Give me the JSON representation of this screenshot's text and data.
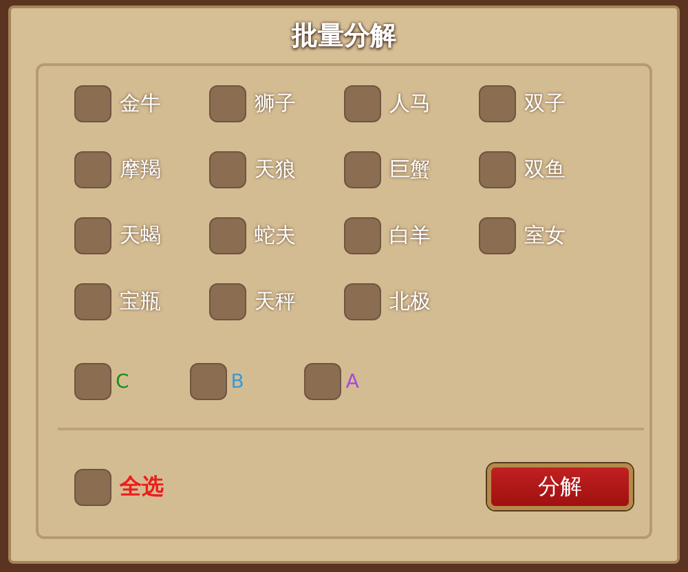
{
  "title": "批量分解",
  "options": [
    {
      "label": "金牛",
      "checked": false
    },
    {
      "label": "狮子",
      "checked": false
    },
    {
      "label": "人马",
      "checked": false
    },
    {
      "label": "双子",
      "checked": false
    },
    {
      "label": "摩羯",
      "checked": false
    },
    {
      "label": "天狼",
      "checked": false
    },
    {
      "label": "巨蟹",
      "checked": false
    },
    {
      "label": "双鱼",
      "checked": false
    },
    {
      "label": "天蝎",
      "checked": false
    },
    {
      "label": "蛇夫",
      "checked": false
    },
    {
      "label": "白羊",
      "checked": false
    },
    {
      "label": "室女",
      "checked": false
    },
    {
      "label": "宝瓶",
      "checked": false
    },
    {
      "label": "天秤",
      "checked": false
    },
    {
      "label": "北极",
      "checked": false
    }
  ],
  "grades": [
    {
      "label": "C",
      "color": "#1c8f1c",
      "checked": false
    },
    {
      "label": "B",
      "color": "#3a9ad6",
      "checked": false
    },
    {
      "label": "A",
      "color": "#a448e0",
      "checked": false
    }
  ],
  "select_all": {
    "label": "全选",
    "checked": false
  },
  "confirm_button": "分解"
}
